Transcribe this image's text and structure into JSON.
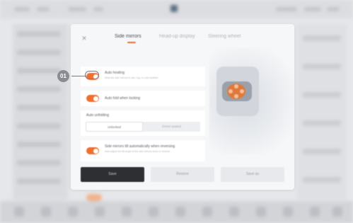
{
  "dialog": {
    "close_icon": "close-icon",
    "tabs": [
      {
        "label": "Side mirrors",
        "active": true
      },
      {
        "label": "Head-up display",
        "active": false
      },
      {
        "label": "Steering wheel",
        "active": false
      }
    ],
    "settings": {
      "auto_heating": {
        "title": "Auto heating",
        "subtitle": "Heat the side mirrors in rain, fog, or cold weather",
        "enabled": true
      },
      "auto_fold": {
        "title": "Auto fold when locking",
        "enabled": true
      },
      "auto_unfolding": {
        "title": "Auto unfolding",
        "options": [
          "Unlocked",
          "Driver seated"
        ],
        "selected": "Unlocked"
      },
      "tilt_reversing": {
        "title": "Side mirrors tilt automatically when reversing",
        "subtitle": "Auto-adjust the tilt angle of the side mirrors when in reverse",
        "enabled": true
      }
    },
    "buttons": {
      "save": "Save",
      "restore": "Restore",
      "save_as": "Save as"
    }
  },
  "callout": {
    "number": "01"
  },
  "colors": {
    "accent": "#ef6f30",
    "primary_button": "#2e2f33",
    "callout": "#8a8c92"
  }
}
